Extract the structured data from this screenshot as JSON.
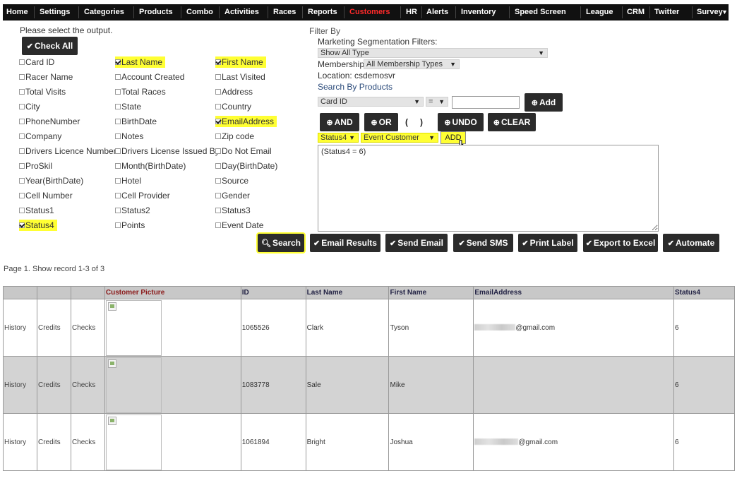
{
  "nav": {
    "items": [
      {
        "label": "Home",
        "active": false
      },
      {
        "label": "Settings",
        "active": false
      },
      {
        "label": "Categories",
        "active": false
      },
      {
        "label": "Products",
        "active": false
      },
      {
        "label": "Combo",
        "active": false
      },
      {
        "label": "Activities",
        "active": false
      },
      {
        "label": "Races",
        "active": false
      },
      {
        "label": "Reports",
        "active": false
      },
      {
        "label": "Customers",
        "active": true
      },
      {
        "label": "HR",
        "active": false
      },
      {
        "label": "Alerts",
        "active": false
      },
      {
        "label": "Inventory",
        "active": false
      },
      {
        "label": "Speed Screen",
        "active": false
      },
      {
        "label": "League",
        "active": false
      },
      {
        "label": "CRM",
        "active": false
      },
      {
        "label": "Twitter",
        "active": false
      },
      {
        "label": "Survey",
        "active": false
      }
    ],
    "scroll_arrow": "▼"
  },
  "output": {
    "prompt": "Please select the output.",
    "check_all_label": "Check All",
    "fields": [
      {
        "label": "Card ID",
        "checked": false
      },
      {
        "label": "Last Name",
        "checked": true
      },
      {
        "label": "First Name",
        "checked": true
      },
      {
        "label": "Racer Name",
        "checked": false
      },
      {
        "label": "Account Created",
        "checked": false
      },
      {
        "label": "Last Visited",
        "checked": false
      },
      {
        "label": "Total Visits",
        "checked": false
      },
      {
        "label": "Total Races",
        "checked": false
      },
      {
        "label": "Address",
        "checked": false
      },
      {
        "label": "City",
        "checked": false
      },
      {
        "label": "State",
        "checked": false
      },
      {
        "label": "Country",
        "checked": false
      },
      {
        "label": "PhoneNumber",
        "checked": false
      },
      {
        "label": "BirthDate",
        "checked": false
      },
      {
        "label": "EmailAddress",
        "checked": true
      },
      {
        "label": "Company",
        "checked": false
      },
      {
        "label": "Notes",
        "checked": false
      },
      {
        "label": "Zip code",
        "checked": false
      },
      {
        "label": "Drivers Licence Number",
        "checked": false
      },
      {
        "label": "Drivers License Issued By",
        "checked": false
      },
      {
        "label": "Do Not Email",
        "checked": false
      },
      {
        "label": "ProSkil",
        "checked": false
      },
      {
        "label": "Month(BirthDate)",
        "checked": false
      },
      {
        "label": "Day(BirthDate)",
        "checked": false
      },
      {
        "label": "Year(BirthDate)",
        "checked": false
      },
      {
        "label": "Hotel",
        "checked": false
      },
      {
        "label": "Source",
        "checked": false
      },
      {
        "label": "Cell Number",
        "checked": false
      },
      {
        "label": "Cell Provider",
        "checked": false
      },
      {
        "label": "Gender",
        "checked": false
      },
      {
        "label": "Status1",
        "checked": false
      },
      {
        "label": "Status2",
        "checked": false
      },
      {
        "label": "Status3",
        "checked": false
      },
      {
        "label": "Status4",
        "checked": true
      },
      {
        "label": "Points",
        "checked": false
      },
      {
        "label": "Event Date",
        "checked": false
      }
    ]
  },
  "filter": {
    "title": "Filter By",
    "segmentation_label": "Marketing Segmentation Filters:",
    "segmentation_value": "Show All Type",
    "membership_label": "Membership:",
    "membership_value": "All Membership Types",
    "location_label": "Location:",
    "location_value": "csdemosvr",
    "search_products_label": "Search By Products",
    "field_select": "Card ID",
    "operator_select": "=",
    "value_input": "",
    "add_label": "Add",
    "and_label": "AND",
    "or_label": "OR",
    "open_paren": "(",
    "close_paren": ")",
    "undo_label": "UNDO",
    "clear_label": "CLEAR",
    "status_select": "Status4",
    "status_value_select": "Event Customer",
    "status_add_label": "ADD",
    "expression": "(Status4 = 6)"
  },
  "actions": {
    "search": "Search",
    "email_results": "Email Results",
    "send_email": "Send Email",
    "send_sms": "Send SMS",
    "print_label": "Print Label",
    "export_excel": "Export to Excel",
    "automate": "Automate"
  },
  "paging": "Page 1. Show record 1-3 of 3",
  "table": {
    "headers": [
      "",
      "",
      "",
      "Customer Picture",
      "ID",
      "Last Name",
      "First Name",
      "EmailAddress",
      "Status4"
    ],
    "rows": [
      {
        "history": "History",
        "credits": "Credits",
        "checks": "Checks",
        "id": "1065526",
        "last": "Clark",
        "first": "Tyson",
        "email_suffix": "@gmail.com",
        "email_redacted": true,
        "status4": "6"
      },
      {
        "history": "History",
        "credits": "Credits",
        "checks": "Checks",
        "id": "1083778",
        "last": "Sale",
        "first": "Mike",
        "email_suffix": "",
        "email_redacted": false,
        "status4": "6"
      },
      {
        "history": "History",
        "credits": "Credits",
        "checks": "Checks",
        "id": "1061894",
        "last": "Bright",
        "first": "Joshua",
        "email_suffix": "@gmail.com",
        "email_redacted": true,
        "status4": "6"
      }
    ]
  },
  "colors": {
    "highlight": "#ffff33",
    "nav_bg": "#111111",
    "active_nav": "#ff2a2a",
    "button_dark": "#2b2b2b"
  }
}
